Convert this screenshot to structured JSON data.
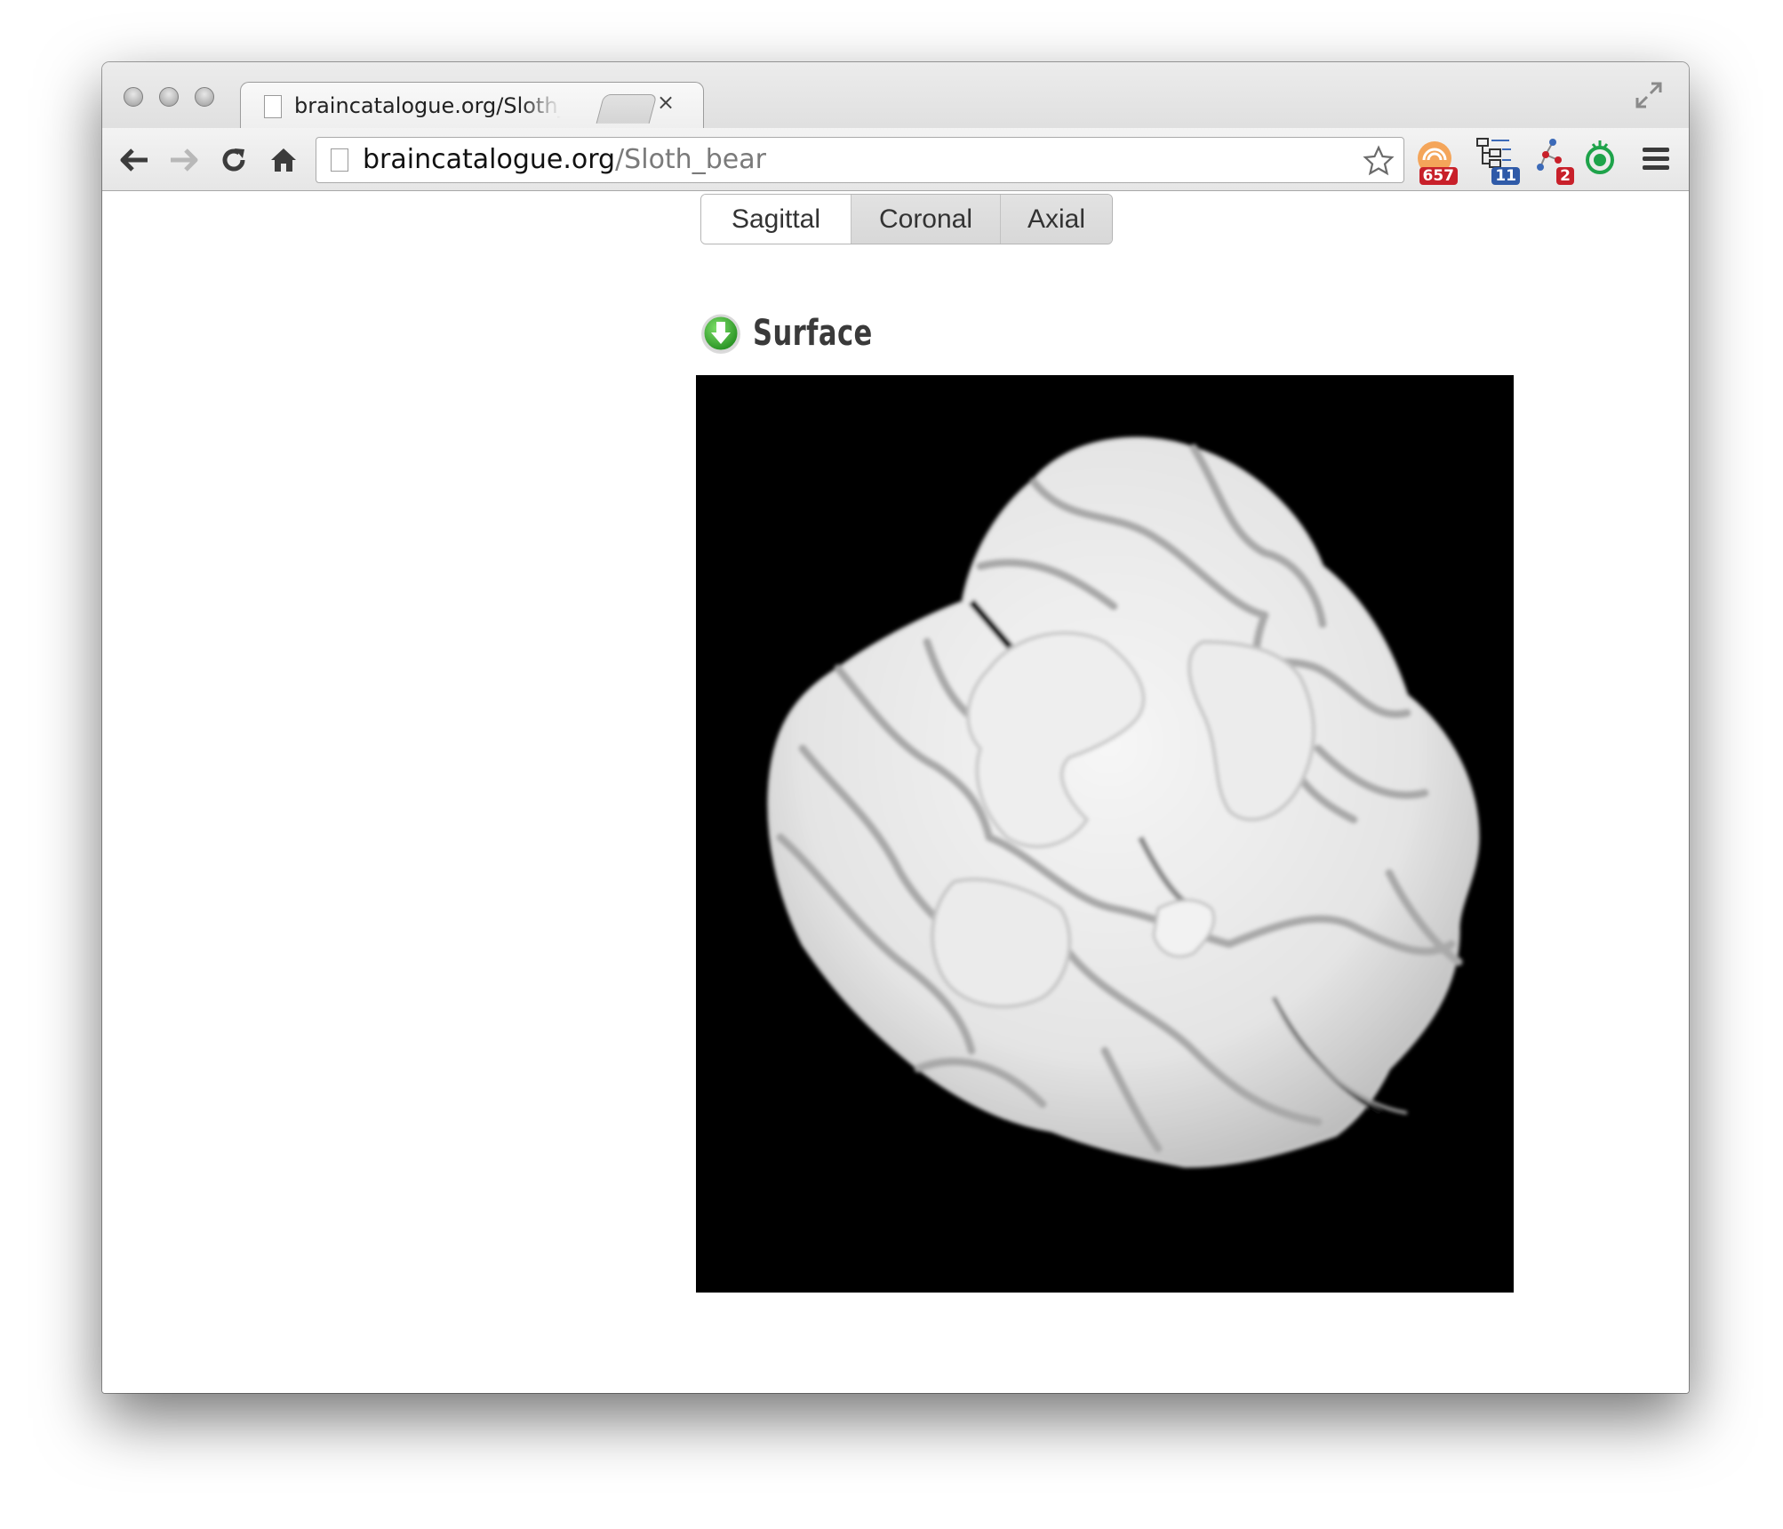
{
  "browser": {
    "tab": {
      "title": "braincatalogue.org/Sloth_bear",
      "close": "×"
    },
    "address_bar": {
      "host": "braincatalogue.org",
      "path": "/Sloth_bear"
    },
    "extensions": [
      {
        "name": "rss-feed-icon",
        "badge": "657",
        "badge_color": "#c8202a"
      },
      {
        "name": "tree-structure-icon",
        "badge": "11",
        "badge_color": "#2f5aa8"
      },
      {
        "name": "molecule-icon",
        "badge": "2",
        "badge_color": "#c8202a"
      },
      {
        "name": "green-robot-icon",
        "badge": "",
        "badge_color": "#1ea34a"
      }
    ]
  },
  "views": {
    "tabs": [
      {
        "label": "Sagittal",
        "active": true
      },
      {
        "label": "Coronal",
        "active": false
      },
      {
        "label": "Axial",
        "active": false
      }
    ]
  },
  "section": {
    "title": "Surface"
  },
  "colors": {
    "viewer_background": "#000000",
    "download_icon": "#2fa82b"
  }
}
